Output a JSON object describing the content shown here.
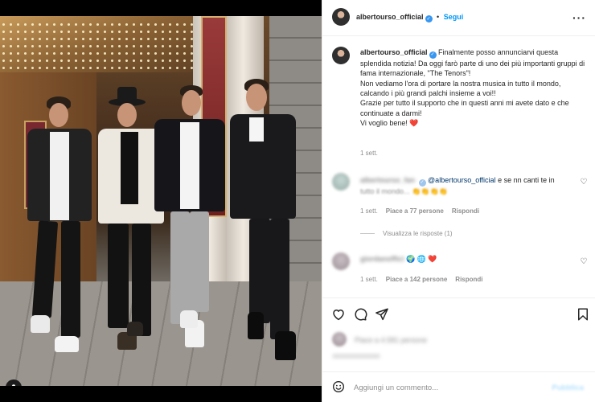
{
  "header": {
    "username": "albertourso_official",
    "separator": "•",
    "follow_label": "Segui",
    "more_icon": "more-horizontal-icon"
  },
  "caption": {
    "username": "albertourso_official",
    "text_1": "Finalmente posso annunciarvi questa splendida notizia! Da oggi farò parte di uno dei più importanti gruppi di fama internazionale, \"The Tenors\"!",
    "text_2": "Non vediamo l'ora di portare la nostra musica in tutto il mondo, calcando i più grandi palchi insieme a voi!!",
    "text_3": "Grazie per tutto il supporto che in questi anni mi avete dato e che continuate a darmi!",
    "text_4": "Vi voglio bene! ❤️",
    "time": "1 sett."
  },
  "comments": [
    {
      "username": "albertourso_fan",
      "mention": "@albertourso_official",
      "text_after": " e se nn canti te in",
      "text_blur": "tutto il mondo... 👏👏👏👏",
      "time": "1 sett.",
      "likes": "Piace a 77 persone",
      "reply": "Rispondi",
      "view_replies": "Visualizza le risposte (1)"
    },
    {
      "username": "giordanoffici",
      "emoji": "🌍 🌐 ❤️",
      "time": "1 sett.",
      "likes": "Piace a 142 persone",
      "reply": "Rispondi"
    }
  ],
  "actions": {
    "like_icon": "heart-icon",
    "comment_icon": "comment-icon",
    "share_icon": "paper-plane-icon",
    "save_icon": "bookmark-icon"
  },
  "likes_blur": "Piace a 4.581 persone",
  "add_comment": {
    "emoji_icon": "smiley-icon",
    "placeholder": "Aggiungi un commento...",
    "post_label": "Pubblica"
  }
}
